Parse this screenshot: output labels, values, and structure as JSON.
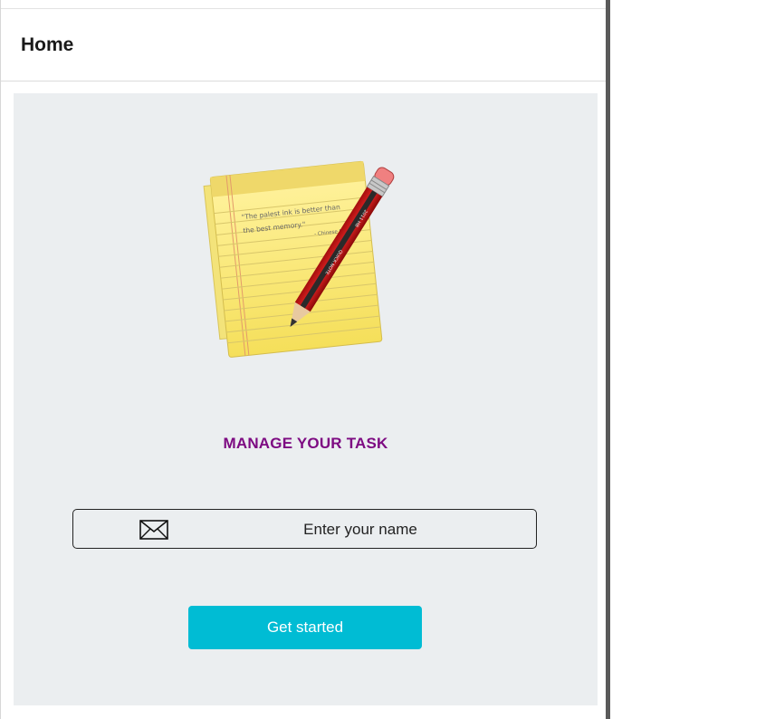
{
  "header": {
    "title": "Home"
  },
  "illustration": {
    "icon": "notepad-pencil-icon",
    "note_line1": "\"The palest ink is better than",
    "note_line2": "the best memory.\"",
    "note_attribution": "- Chinese Proverb",
    "pencil_text1": "QUICK NOTE",
    "pencil_text2": "2011 HB"
  },
  "main": {
    "tagline": "MANAGE YOUR TASK",
    "name_placeholder": "Enter your name",
    "name_value": "",
    "start_label": "Get started"
  },
  "colors": {
    "tagline": "#7d0b82",
    "button": "#00bcd4",
    "content_bg": "#ebeef0"
  }
}
